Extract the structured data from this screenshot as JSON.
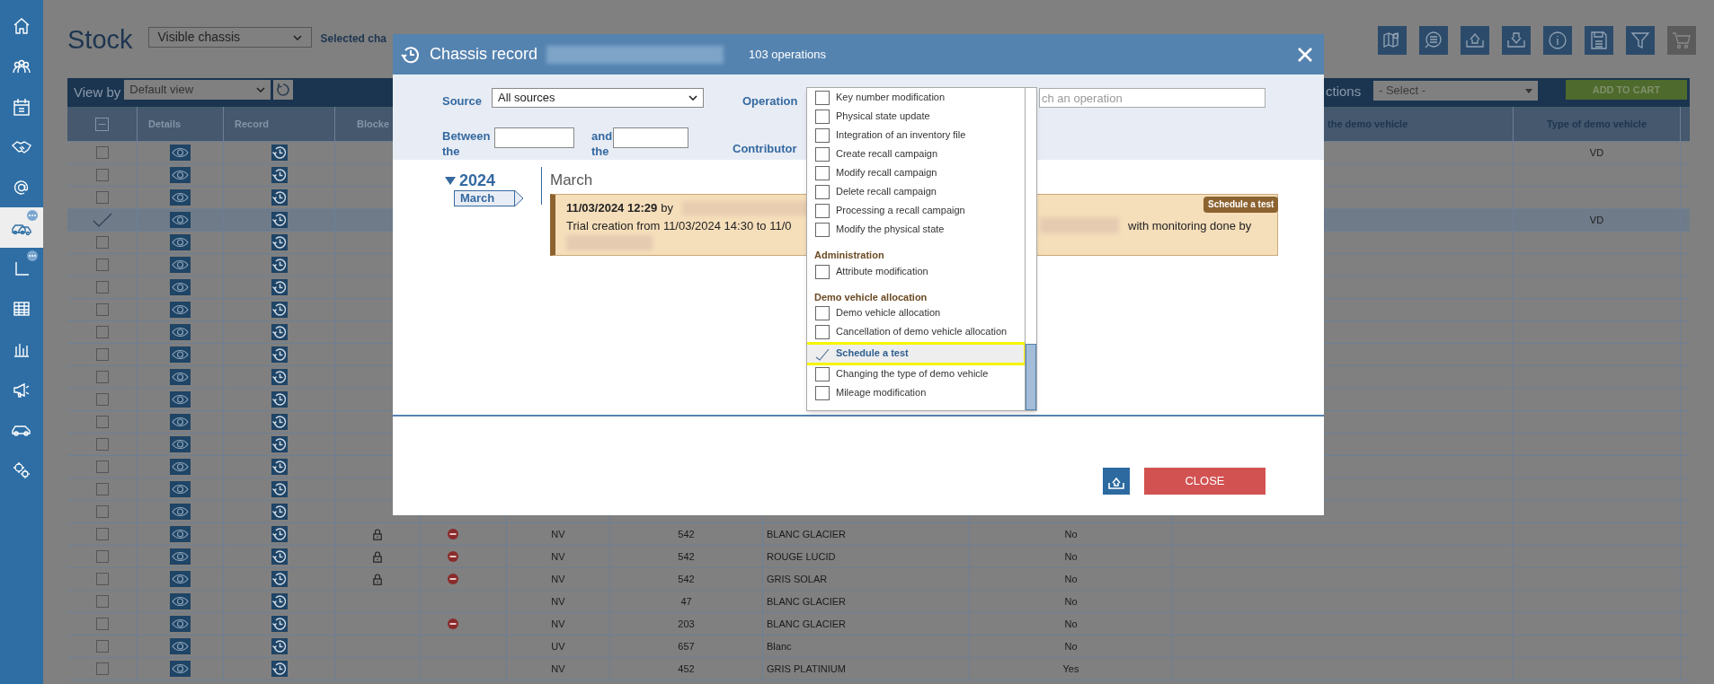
{
  "sidebar": {
    "items": [
      {
        "selected": false,
        "badge": false
      },
      {
        "selected": false,
        "badge": false
      },
      {
        "selected": false,
        "badge": false
      },
      {
        "selected": false,
        "badge": false
      },
      {
        "selected": false,
        "badge": false
      },
      {
        "selected": true,
        "badge": true
      },
      {
        "selected": false,
        "badge": true
      },
      {
        "selected": false,
        "badge": false
      },
      {
        "selected": false,
        "badge": false
      },
      {
        "selected": false,
        "badge": false
      },
      {
        "selected": false,
        "badge": false
      },
      {
        "selected": false,
        "badge": false
      }
    ]
  },
  "page": {
    "title": "Stock",
    "view_select": "Visible chassis",
    "selected_label": "Selected cha"
  },
  "toolbar_buttons": [
    {
      "disabled": false
    },
    {
      "disabled": false
    },
    {
      "disabled": false
    },
    {
      "disabled": false
    },
    {
      "disabled": false
    },
    {
      "disabled": false
    },
    {
      "disabled": false
    },
    {
      "disabled": true
    }
  ],
  "table_bar": {
    "view_by_label": "View by",
    "view_select": "Default view",
    "actions_label": "ctions",
    "actions_select": "- Select -",
    "add_button": "ADD TO CART"
  },
  "table": {
    "header": {
      "select_all_partial": true,
      "details": "Details",
      "record": "Record",
      "blocked": "Blocke",
      "column_10": "the demo vehicle",
      "type_of_demo_vehicle": "Type of demo vehicle"
    },
    "rows": [
      {
        "selected": false,
        "locked": false,
        "type_of_demo_vehicle": "VD"
      },
      {
        "selected": false,
        "locked": false
      },
      {
        "selected": false,
        "locked": false
      },
      {
        "selected": true,
        "locked": false,
        "type_of_demo_vehicle": "VD"
      },
      {
        "selected": false,
        "locked": false
      },
      {
        "selected": false,
        "locked": false
      },
      {
        "selected": false,
        "locked": false
      },
      {
        "selected": false,
        "locked": false
      },
      {
        "selected": false,
        "locked": false
      },
      {
        "selected": false,
        "locked": false
      },
      {
        "selected": false,
        "locked": false
      },
      {
        "selected": false,
        "locked": false
      },
      {
        "selected": false,
        "locked": false
      },
      {
        "selected": false,
        "locked": false
      },
      {
        "selected": false,
        "locked": false
      },
      {
        "selected": false,
        "locked": false
      },
      {
        "selected": false,
        "locked": false
      },
      {
        "selected": false,
        "locked": true,
        "blocked_sign": true,
        "column_6": "NV",
        "column_7": "542",
        "column_8": "BLANC GLACIER",
        "column_9": "No"
      },
      {
        "selected": false,
        "locked": true,
        "blocked_sign": true,
        "column_6": "NV",
        "column_7": "542",
        "column_8": "ROUGE LUCID",
        "column_9": "No"
      },
      {
        "selected": false,
        "locked": true,
        "blocked_sign": true,
        "column_6": "NV",
        "column_7": "542",
        "column_8": "GRIS SOLAR",
        "column_9": "No"
      },
      {
        "selected": false,
        "locked": false,
        "blocked_sign": false,
        "column_6": "NV",
        "column_7": "47",
        "column_8": "BLANC GLACIER",
        "column_9": "No"
      },
      {
        "selected": false,
        "locked": false,
        "blocked_sign": true,
        "column_6": "NV",
        "column_7": "203",
        "column_8": "BLANC GLACIER",
        "column_9": "No"
      },
      {
        "selected": false,
        "locked": false,
        "blocked_sign": false,
        "column_6": "UV",
        "column_7": "657",
        "column_8": "Blanc",
        "column_9": "No"
      },
      {
        "selected": false,
        "locked": false,
        "blocked_sign": false,
        "column_6": "NV",
        "column_7": "452",
        "column_8": "GRIS PLATINIUM",
        "column_9": "Yes"
      }
    ]
  },
  "modal": {
    "title": "Chassis record",
    "count": "103 operations",
    "filters": {
      "source_label": "Source",
      "source_select": "All sources",
      "operation_label": "Operation",
      "operation_placeholder": "ch an operation",
      "between_label": "Between the",
      "and_label": "and the",
      "contributor_label": "Contributor"
    },
    "timeline": {
      "year": "2024",
      "expanded": true,
      "month_tab": "March",
      "month_heading": "March",
      "entry": {
        "date": "11/03/2024 12:29",
        "by": "by",
        "text_start": "Trial creation from 11/03/2024 14:30 to 11/0",
        "text_end": "with monitoring done by",
        "badge": "Schedule a test"
      }
    },
    "operations": [
      {
        "kind": "option",
        "label": "Key number modification",
        "checked": false,
        "highlighted": false
      },
      {
        "kind": "option",
        "label": "Physical state update",
        "checked": false,
        "highlighted": false
      },
      {
        "kind": "option",
        "label": "Integration of an inventory file",
        "checked": false,
        "highlighted": false
      },
      {
        "kind": "option",
        "label": "Create recall campaign",
        "checked": false,
        "highlighted": false
      },
      {
        "kind": "option",
        "label": "Modify recall campaign",
        "checked": false,
        "highlighted": false
      },
      {
        "kind": "option",
        "label": "Delete recall campaign",
        "checked": false,
        "highlighted": false
      },
      {
        "kind": "option",
        "label": "Processing a recall campaign",
        "checked": false,
        "highlighted": false
      },
      {
        "kind": "option",
        "label": "Modify the physical state",
        "checked": false,
        "highlighted": false
      },
      {
        "kind": "group",
        "label": "Administration"
      },
      {
        "kind": "option",
        "label": "Attribute modification",
        "checked": false,
        "highlighted": false
      },
      {
        "kind": "group",
        "label": "Demo vehicle allocation"
      },
      {
        "kind": "option",
        "label": "Demo vehicle allocation",
        "checked": false,
        "highlighted": false
      },
      {
        "kind": "option",
        "label": "Cancellation of demo vehicle allocation",
        "checked": false,
        "highlighted": false
      },
      {
        "kind": "option",
        "label": "Schedule a test",
        "checked": true,
        "highlighted": true
      },
      {
        "kind": "option",
        "label": "Changing the type of demo vehicle",
        "checked": false,
        "highlighted": false
      },
      {
        "kind": "option",
        "label": "Mileage modification",
        "checked": false,
        "highlighted": false
      }
    ],
    "close_button": "CLOSE"
  }
}
